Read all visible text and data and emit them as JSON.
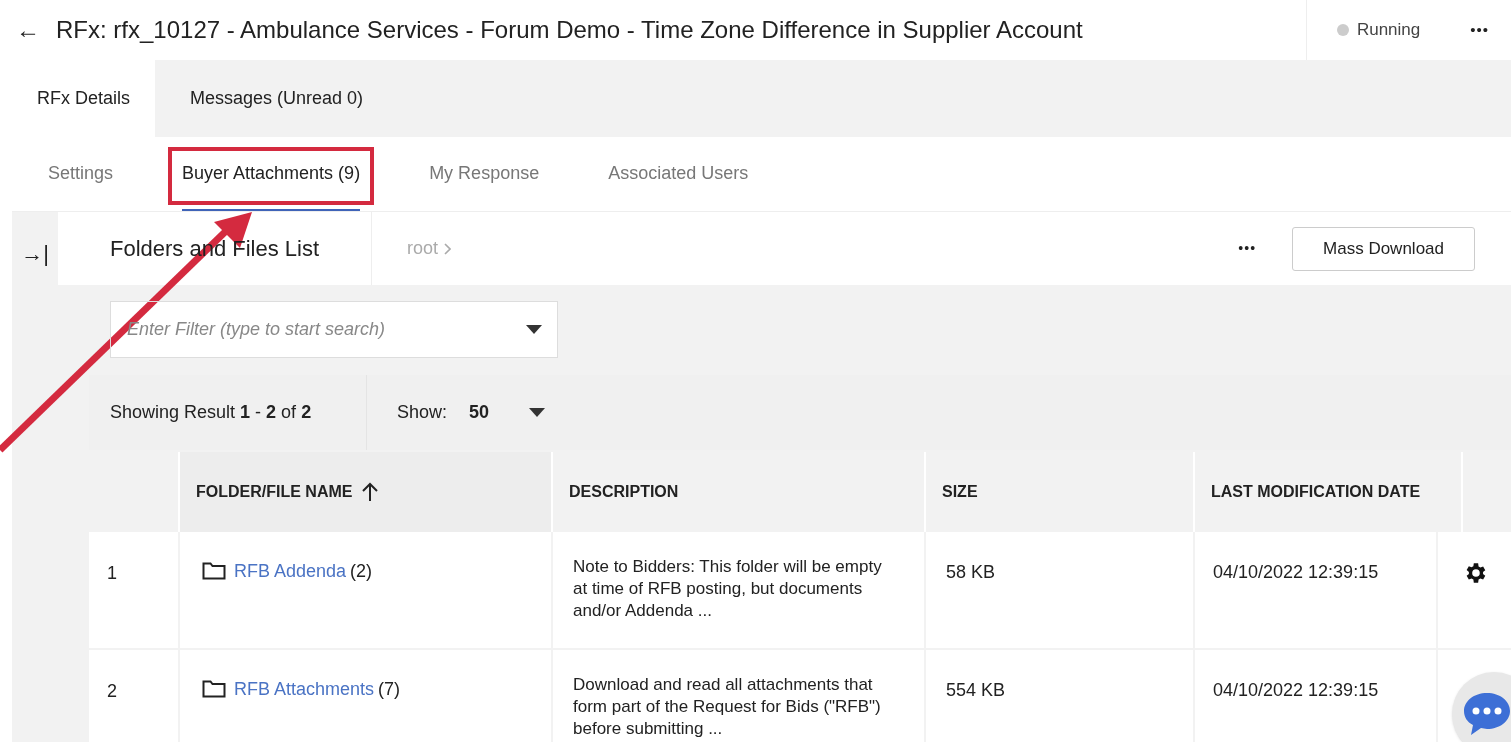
{
  "header": {
    "back": "←",
    "title": "RFx: rfx_10127 - Ambulance Services - Forum Demo - Time Zone Difference in Supplier Account",
    "status": {
      "label": "Running",
      "color": "#cccccc"
    },
    "more": "•••"
  },
  "tabs": [
    {
      "label": "RFx Details",
      "selected": true
    },
    {
      "label": "Messages (Unread 0)",
      "selected": false
    }
  ],
  "subtabs": [
    {
      "label": "Settings",
      "selected": false,
      "highlighted": false
    },
    {
      "label": "Buyer Attachments (9)",
      "selected": true,
      "highlighted": true
    },
    {
      "label": "My Response",
      "selected": false,
      "highlighted": false
    },
    {
      "label": "Associated Users",
      "selected": false,
      "highlighted": false
    }
  ],
  "panel": {
    "collapse": "→|",
    "title": "Folders and Files List",
    "breadcrumb": "root",
    "more": "•••",
    "mass_download": "Mass Download"
  },
  "filter": {
    "placeholder": "Enter Filter (type to start search)"
  },
  "results": {
    "summary": "Showing Result **1** - **2** of **2**",
    "show_label": "Show:",
    "show_value": "50"
  },
  "table": {
    "columns": [
      {
        "sorted": false
      },
      {
        "label": "FOLDER/FILE NAME",
        "sorted": true
      },
      {
        "label": "DESCRIPTION",
        "sorted": false
      },
      {
        "label": "SIZE",
        "sorted": false
      },
      {
        "label": "LAST MODIFICATION DATE",
        "sorted": false
      }
    ],
    "rows": [
      {
        "index": "1",
        "name": "RFB Addenda",
        "count": "(2)",
        "description": "Note to Bidders: This folder will be empty at time of RFB posting, but documents and/or Addenda ...",
        "size": "58 KB",
        "date": "04/10/2022 12:39:15"
      },
      {
        "index": "2",
        "name": "RFB Attachments",
        "count": "(7)",
        "description": "Download and read all attachments that form part of the Request for Bids (\"RFB\") before submitting ...",
        "size": "554 KB",
        "date": "04/10/2022 12:39:15"
      }
    ]
  }
}
